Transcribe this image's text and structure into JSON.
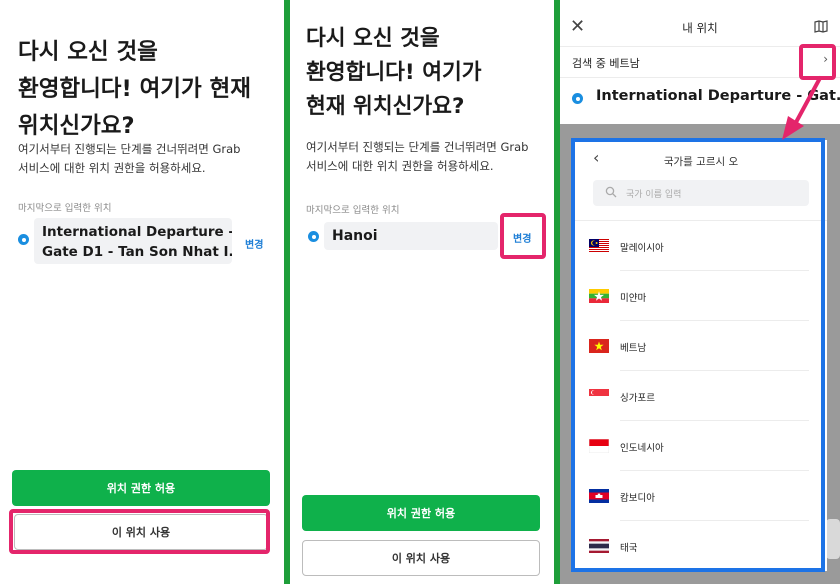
{
  "left": {
    "welcome_lines": [
      "다시 오신 것을",
      "환영합니다! 여기가 현재",
      "위치신가요?"
    ],
    "desc_lines": [
      "여기서부터 진행되는 단계를 건너뛰려면 Grab",
      "서비스에 대한 위치 권한을 허용하세요."
    ],
    "last_label": "마지막으로 입력한 위치",
    "location_lines": [
      "International Departure -",
      "Gate D1 - Tan Son Nhat I..."
    ],
    "change_label": "변경",
    "allow_button": "위치 권한 허용",
    "use_button": "이 위치 사용"
  },
  "middle": {
    "welcome_lines": [
      "다시 오신 것을",
      "환영합니다! 여기가",
      "현재 위치신가요?"
    ],
    "desc_lines": [
      "여기서부터 진행되는 단계를 건너뛰려면 Grab",
      "서비스에 대한 위치 권한을 허용하세요."
    ],
    "last_label": "마지막으로 입력한 위치",
    "location": "Hanoi",
    "change_label": "변경",
    "allow_button": "위치 권한 허용",
    "use_button": "이 위치 사용"
  },
  "right": {
    "title": "내 위치",
    "close_glyph": "✕",
    "searching": "검색 중 베트남",
    "chevron_glyph": "›",
    "location": "International Departure - Gat...",
    "modal": {
      "back_glyph": "‹",
      "title": "국가를 고르시 오",
      "search_placeholder": "국가 이름 입력",
      "countries": [
        {
          "name": "말레이시아",
          "flag": "malaysia-flag-icon"
        },
        {
          "name": "미얀마",
          "flag": "myanmar-flag-icon"
        },
        {
          "name": "베트남",
          "flag": "vietnam-flag-icon"
        },
        {
          "name": "싱가포르",
          "flag": "singapore-flag-icon"
        },
        {
          "name": "인도네시아",
          "flag": "indonesia-flag-icon"
        },
        {
          "name": "캄보디아",
          "flag": "cambodia-flag-icon"
        },
        {
          "name": "태국",
          "flag": "thailand-flag-icon"
        }
      ]
    }
  },
  "colors": {
    "grab_green": "#0fb14b",
    "divider_green": "#1e9e3a",
    "highlight_pink": "#e4256b",
    "highlight_blue": "#1d73e6",
    "link_blue": "#1f7fd6"
  }
}
